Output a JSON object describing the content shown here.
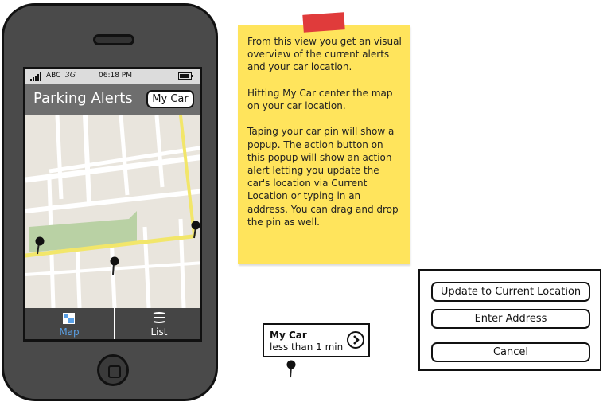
{
  "status_bar": {
    "carrier": "ABC",
    "network": "3G",
    "time": "06:18 PM"
  },
  "nav": {
    "title": "Parking Alerts",
    "my_car_label": "My Car"
  },
  "tabs": [
    {
      "label": "Map",
      "icon": "map-icon",
      "active": true
    },
    {
      "label": "List",
      "icon": "list-icon",
      "active": false
    }
  ],
  "note": {
    "paragraphs": [
      "From this view you get an visual overview of the current alerts and your car location.",
      "Hitting My Car center the map on your car location.",
      "Taping your car pin will show a popup. The action button on this popup will show an action alert letting you update the car's location via Current Location or typing in an address. You can drag and drop the pin as well."
    ]
  },
  "popup": {
    "title": "My Car",
    "subtitle": "less than 1 min"
  },
  "action_sheet": {
    "update_label": "Update to Current Location",
    "address_label": "Enter Address",
    "cancel_label": "Cancel"
  },
  "colors": {
    "note_yellow": "#ffe45c",
    "tape_red": "#e03b3b",
    "tab_active": "#5aa0e6",
    "map_road_yellow": "#f2e66a",
    "map_park": "#b9d1a4"
  }
}
